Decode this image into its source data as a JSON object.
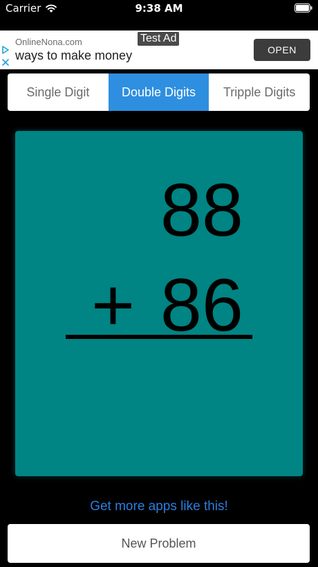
{
  "status_bar": {
    "carrier": "Carrier",
    "time": "9:38 AM",
    "icons": [
      "wifi-icon",
      "battery-icon"
    ]
  },
  "ad": {
    "badge": "Test Ad",
    "source": "OnlineNona.com",
    "headline": "ways to make money",
    "open_label": "OPEN",
    "icons": [
      "ad-play-icon",
      "ad-close-icon"
    ]
  },
  "difficulty": {
    "options": [
      "Single Digit",
      "Double Digits",
      "Tripple Digits"
    ],
    "selected": "Double Digits"
  },
  "problem": {
    "top_number": "88",
    "operator": "+",
    "bottom_number": "86"
  },
  "links": {
    "more_apps": "Get more apps like this!"
  },
  "actions": {
    "new_problem": "New Problem"
  },
  "colors": {
    "background": "#000000",
    "card": "#008484",
    "accent": "#2e8fe0",
    "link": "#2a7fe0"
  }
}
